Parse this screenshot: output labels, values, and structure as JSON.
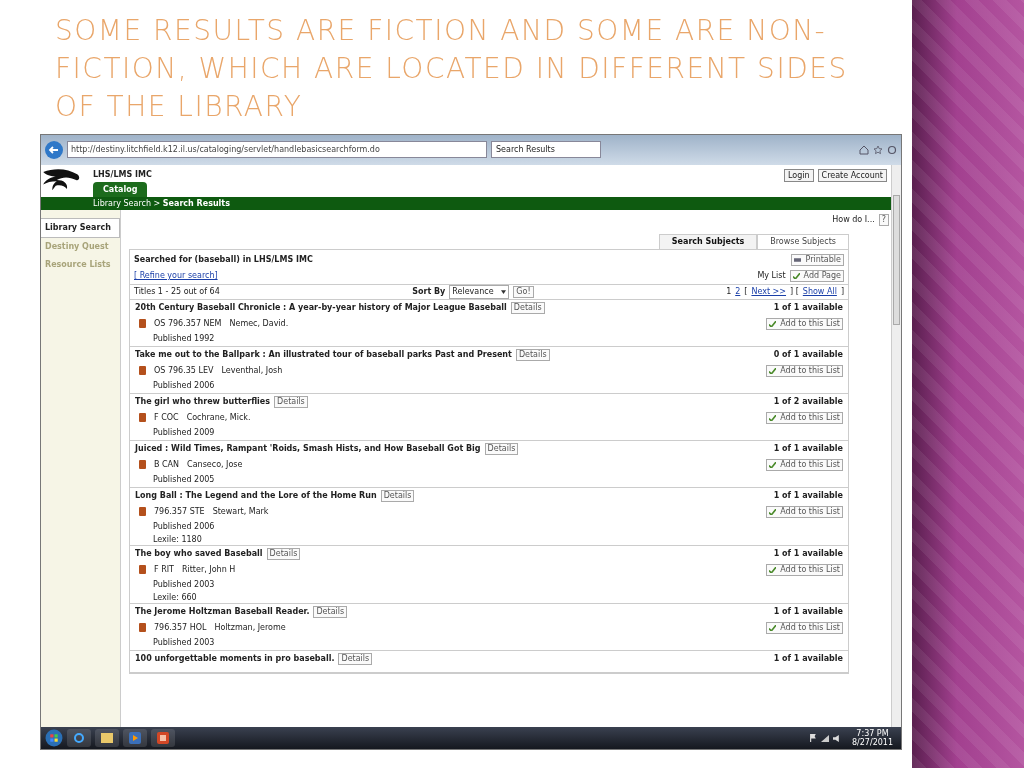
{
  "slide": {
    "title": "SOME RESULTS ARE FICTION AND SOME ARE NON-FICTION, WHICH ARE LOCATED IN DIFFERENT SIDES OF THE LIBRARY"
  },
  "browser": {
    "address": "http://destiny.litchfield.k12.il.us/cataloging/servlet/handlebasicsearchform.do",
    "tab": "Search Results"
  },
  "site": {
    "name": "LHS/LMS IMC",
    "header_buttons": [
      "Login",
      "Create Account"
    ],
    "catalog_tab": "Catalog",
    "breadcrumb": "Library Search > **Search Results**"
  },
  "sidebar": [
    {
      "label": "Library Search",
      "selected": true
    },
    {
      "label": "Destiny Quest",
      "selected": false
    },
    {
      "label": "Resource Lists",
      "selected": false
    }
  ],
  "help": {
    "label": "How do I...",
    "button": "?"
  },
  "search_tabs": [
    {
      "label": "Search Subjects",
      "selected": true
    },
    {
      "label": "Browse Subjects",
      "selected": false
    }
  ],
  "summary": {
    "heading": "Searched for (baseball) in LHS/LMS IMC",
    "refine": "[ Refine your search]",
    "printable": "Printable",
    "my_list": "My List",
    "add_page": "Add Page"
  },
  "toolbar": {
    "count": "Titles 1 - 25 out of 64",
    "sort_label": "Sort By",
    "sort_value": "Relevance",
    "go": "Go!",
    "pager": [
      {
        "kind": "text",
        "label": "1"
      },
      {
        "kind": "link",
        "label": "2"
      },
      {
        "kind": "text",
        "label": "["
      },
      {
        "kind": "link",
        "label": "Next >>"
      },
      {
        "kind": "text",
        "label": "] ["
      },
      {
        "kind": "link",
        "label": "Show All"
      },
      {
        "kind": "text",
        "label": "]"
      }
    ]
  },
  "results": [
    {
      "title": "20th Century Baseball Chronicle : A year-by-year history of Major League Baseball",
      "details": "Details",
      "call_number": "OS 796.357 NEM",
      "author": "Nemec, David.",
      "lines": [
        "Published 1992"
      ],
      "availability": "1 of 1 available",
      "add": "Add to this List"
    },
    {
      "title": "Take me out to the Ballpark : An illustrated tour of baseball parks Past and Present",
      "details": "Details",
      "call_number": "OS 796.35 LEV",
      "author": "Leventhal, Josh",
      "lines": [
        "Published 2006"
      ],
      "availability": "0 of 1 available",
      "add": "Add to this List"
    },
    {
      "title": "The girl who threw butterflies",
      "details": "Details",
      "call_number": "F COC",
      "author": "Cochrane, Mick.",
      "lines": [
        "Published 2009"
      ],
      "availability": "1 of 2 available",
      "add": "Add to this List"
    },
    {
      "title": "Juiced : Wild Times, Rampant 'Roids, Smash Hists, and How Baseball Got Big",
      "details": "Details",
      "call_number": "B CAN",
      "author": "Canseco, Jose",
      "lines": [
        "Published 2005"
      ],
      "availability": "1 of 1 available",
      "add": "Add to this List"
    },
    {
      "title": "Long Ball : The Legend and the Lore of the Home Run",
      "details": "Details",
      "call_number": "796.357 STE",
      "author": "Stewart, Mark",
      "lines": [
        "Published 2006",
        "Lexile: 1180"
      ],
      "availability": "1 of 1 available",
      "add": "Add to this List"
    },
    {
      "title": "The boy who saved Baseball",
      "details": "Details",
      "call_number": "F RIT",
      "author": "Ritter, John H",
      "lines": [
        "Published 2003",
        "Lexile: 660"
      ],
      "availability": "1 of 1 available",
      "add": "Add to this List"
    },
    {
      "title": "The Jerome Holtzman Baseball Reader.",
      "details": "Details",
      "call_number": "796.357 HOL",
      "author": "Holtzman, Jerome",
      "lines": [
        "Published 2003"
      ],
      "availability": "1 of 1 available",
      "add": "Add to this List"
    },
    {
      "title": "100 unforgettable moments in pro baseball.",
      "details": "Details",
      "availability": "1 of 1 available"
    }
  ],
  "taskbar": {
    "time": "7:37 PM",
    "date": "8/27/2011"
  }
}
